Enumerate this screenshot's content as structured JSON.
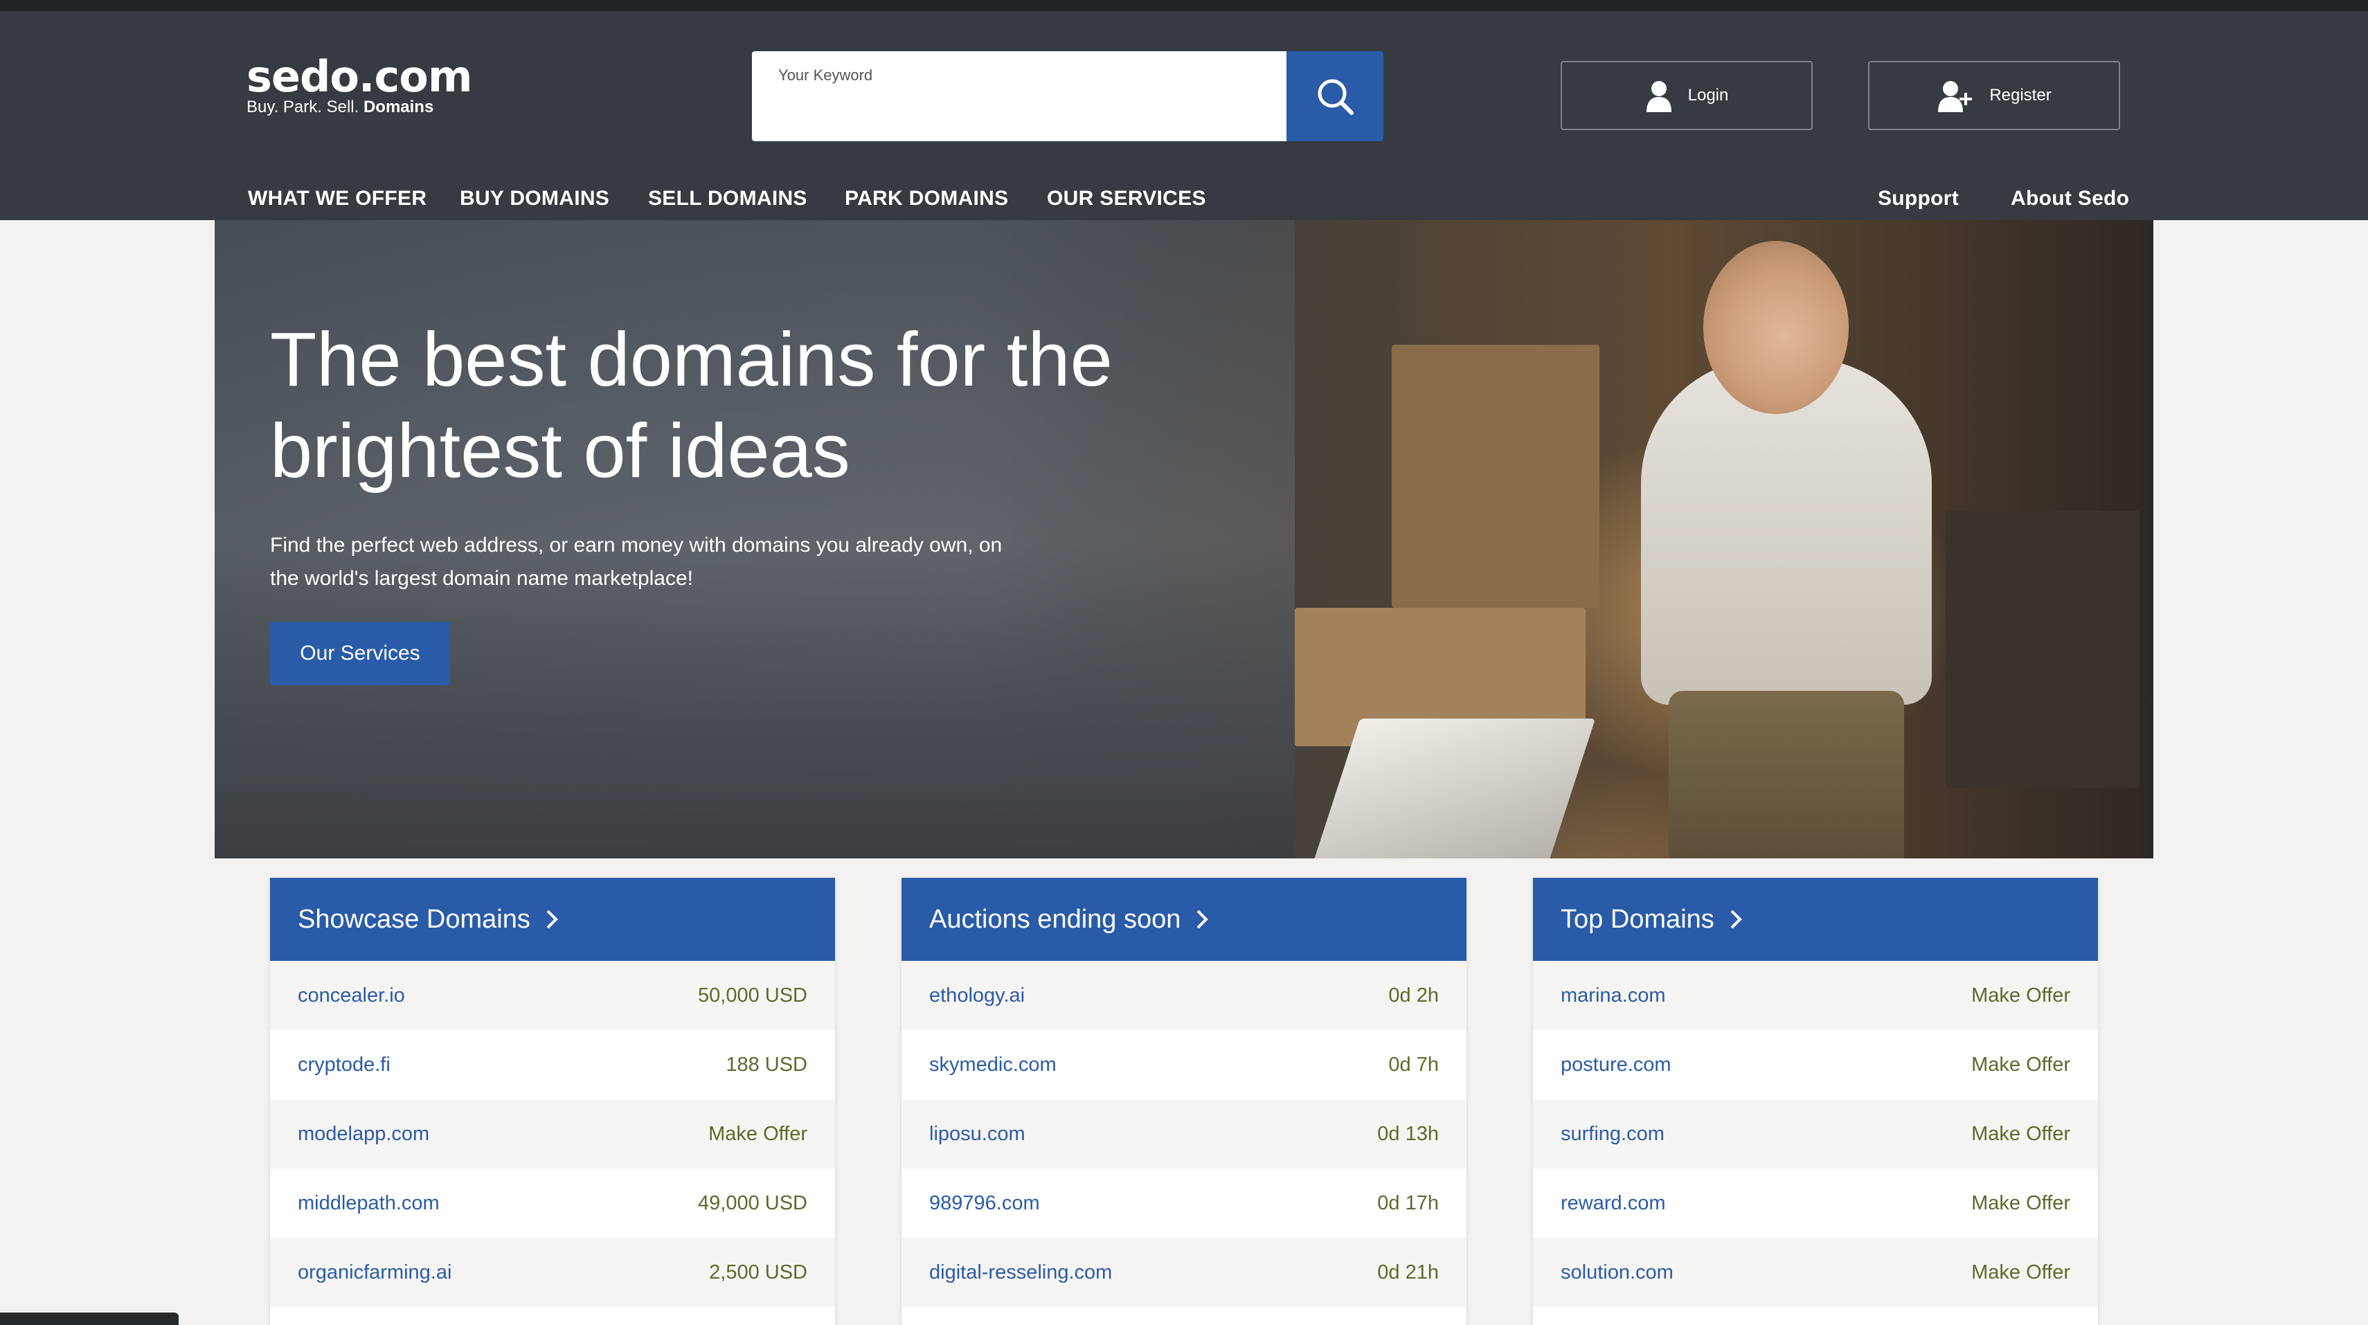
{
  "logo": {
    "main": "sedo.com",
    "tag_plain": "Buy.  Park.  Sell.",
    "tag_bold": "Domains"
  },
  "search": {
    "label": "Your Keyword",
    "value": "",
    "icon": "search-icon"
  },
  "account": {
    "login_label": "Login",
    "register_label": "Register",
    "login_icon": "user-icon",
    "register_icon": "user-plus-icon"
  },
  "nav": {
    "items": [
      "WHAT WE OFFER",
      "BUY DOMAINS",
      "SELL DOMAINS",
      "PARK DOMAINS",
      "OUR SERVICES"
    ],
    "support": "Support",
    "about": "About Sedo"
  },
  "hero": {
    "title": "The best domains for the brightest of ideas",
    "subtitle": "Find the perfect web address, or earn money with domains you already own, on the world's largest domain name marketplace!",
    "button": "Our Services"
  },
  "panels": [
    {
      "title": "Showcase Domains",
      "rows": [
        {
          "name": "concealer.io",
          "value": "50,000 USD"
        },
        {
          "name": "cryptode.fi",
          "value": "188 USD"
        },
        {
          "name": "modelapp.com",
          "value": "Make Offer"
        },
        {
          "name": "middlepath.com",
          "value": "49,000 USD"
        },
        {
          "name": "organicfarming.ai",
          "value": "2,500 USD"
        }
      ]
    },
    {
      "title": "Auctions ending soon",
      "rows": [
        {
          "name": "ethology.ai",
          "value": "0d 2h"
        },
        {
          "name": "skymedic.com",
          "value": "0d 7h"
        },
        {
          "name": "liposu.com",
          "value": "0d 13h"
        },
        {
          "name": "989796.com",
          "value": "0d 17h"
        },
        {
          "name": "digital-resseling.com",
          "value": "0d 21h"
        }
      ]
    },
    {
      "title": "Top Domains",
      "rows": [
        {
          "name": "marina.com",
          "value": "Make Offer"
        },
        {
          "name": "posture.com",
          "value": "Make Offer"
        },
        {
          "name": "surfing.com",
          "value": "Make Offer"
        },
        {
          "name": "reward.com",
          "value": "Make Offer"
        },
        {
          "name": "solution.com",
          "value": "Make Offer"
        }
      ]
    }
  ],
  "colors": {
    "header_bg": "#353b40",
    "accent": "#2a5ba8",
    "link": "#2a5ba8",
    "value_text": "#5a6b2a"
  }
}
